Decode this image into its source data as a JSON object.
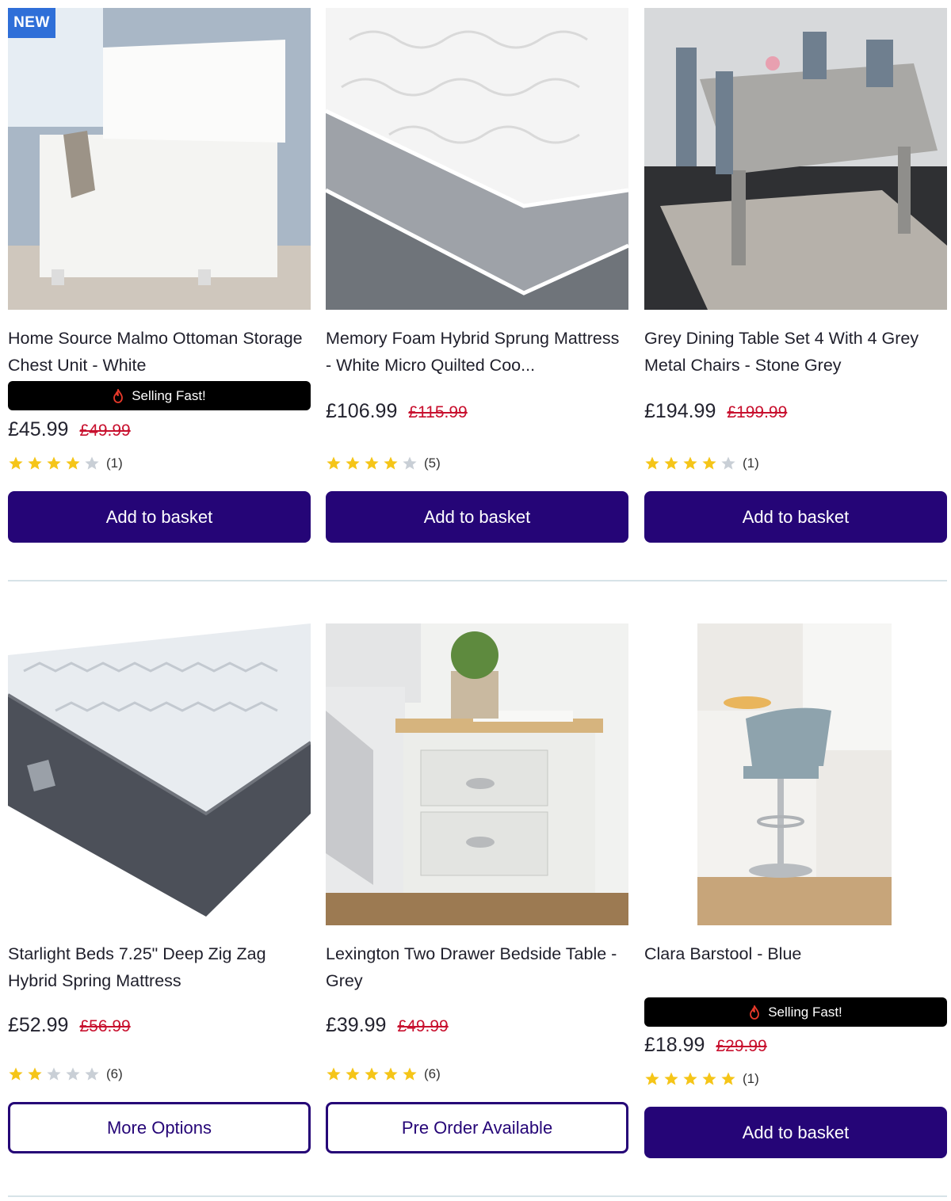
{
  "rows": [
    [
      {
        "title": "Home Source Malmo Ottoman Storage Chest Unit - White",
        "badge_new": "NEW",
        "selling_fast": "Selling Fast!",
        "price": "£45.99",
        "was": "£49.99",
        "rating": 4,
        "reviews": "(1)",
        "button": "Add to basket",
        "button_style": "solid",
        "image": "white-ottoman-storage-chest"
      },
      {
        "title": "Memory Foam Hybrid Sprung Mattress - White Micro Quilted Coo...",
        "price": "£106.99",
        "was": "£115.99",
        "rating": 4,
        "reviews": "(5)",
        "button": "Add to basket",
        "button_style": "solid",
        "image": "quilted-mattress-corner"
      },
      {
        "title": "Grey Dining Table Set 4 With 4 Grey Metal Chairs - Stone Grey",
        "price": "£194.99",
        "was": "£199.99",
        "rating": 4,
        "reviews": "(1)",
        "button": "Add to basket",
        "button_style": "solid",
        "image": "grey-dining-table-set"
      }
    ],
    [
      {
        "title": "Starlight Beds 7.25\" Deep Zig Zag Hybrid Spring Mattress",
        "price": "£52.99",
        "was": "£56.99",
        "rating": 2,
        "reviews": "(6)",
        "button": "More Options",
        "button_style": "outline",
        "image": "zig-zag-mattress"
      },
      {
        "title": "Lexington Two Drawer Bedside Table - Grey",
        "price": "£39.99",
        "was": "£49.99",
        "rating": 5,
        "reviews": "(6)",
        "button": "Pre Order Available",
        "button_style": "outline",
        "image": "grey-bedside-table"
      },
      {
        "title": "Clara Barstool - Blue",
        "selling_fast": "Selling Fast!",
        "price": "£18.99",
        "was": "£29.99",
        "rating": 5,
        "reviews": "(1)",
        "button": "Add to basket",
        "button_style": "solid",
        "image": "blue-barstool"
      }
    ]
  ],
  "colors": {
    "button": "#250577",
    "was_price": "#c8102e",
    "star_on": "#f5c518",
    "star_off": "#c9cfd6",
    "new_badge": "#2f6fd8",
    "selling_fast_bg": "#000000",
    "flame": "#e8392a"
  }
}
